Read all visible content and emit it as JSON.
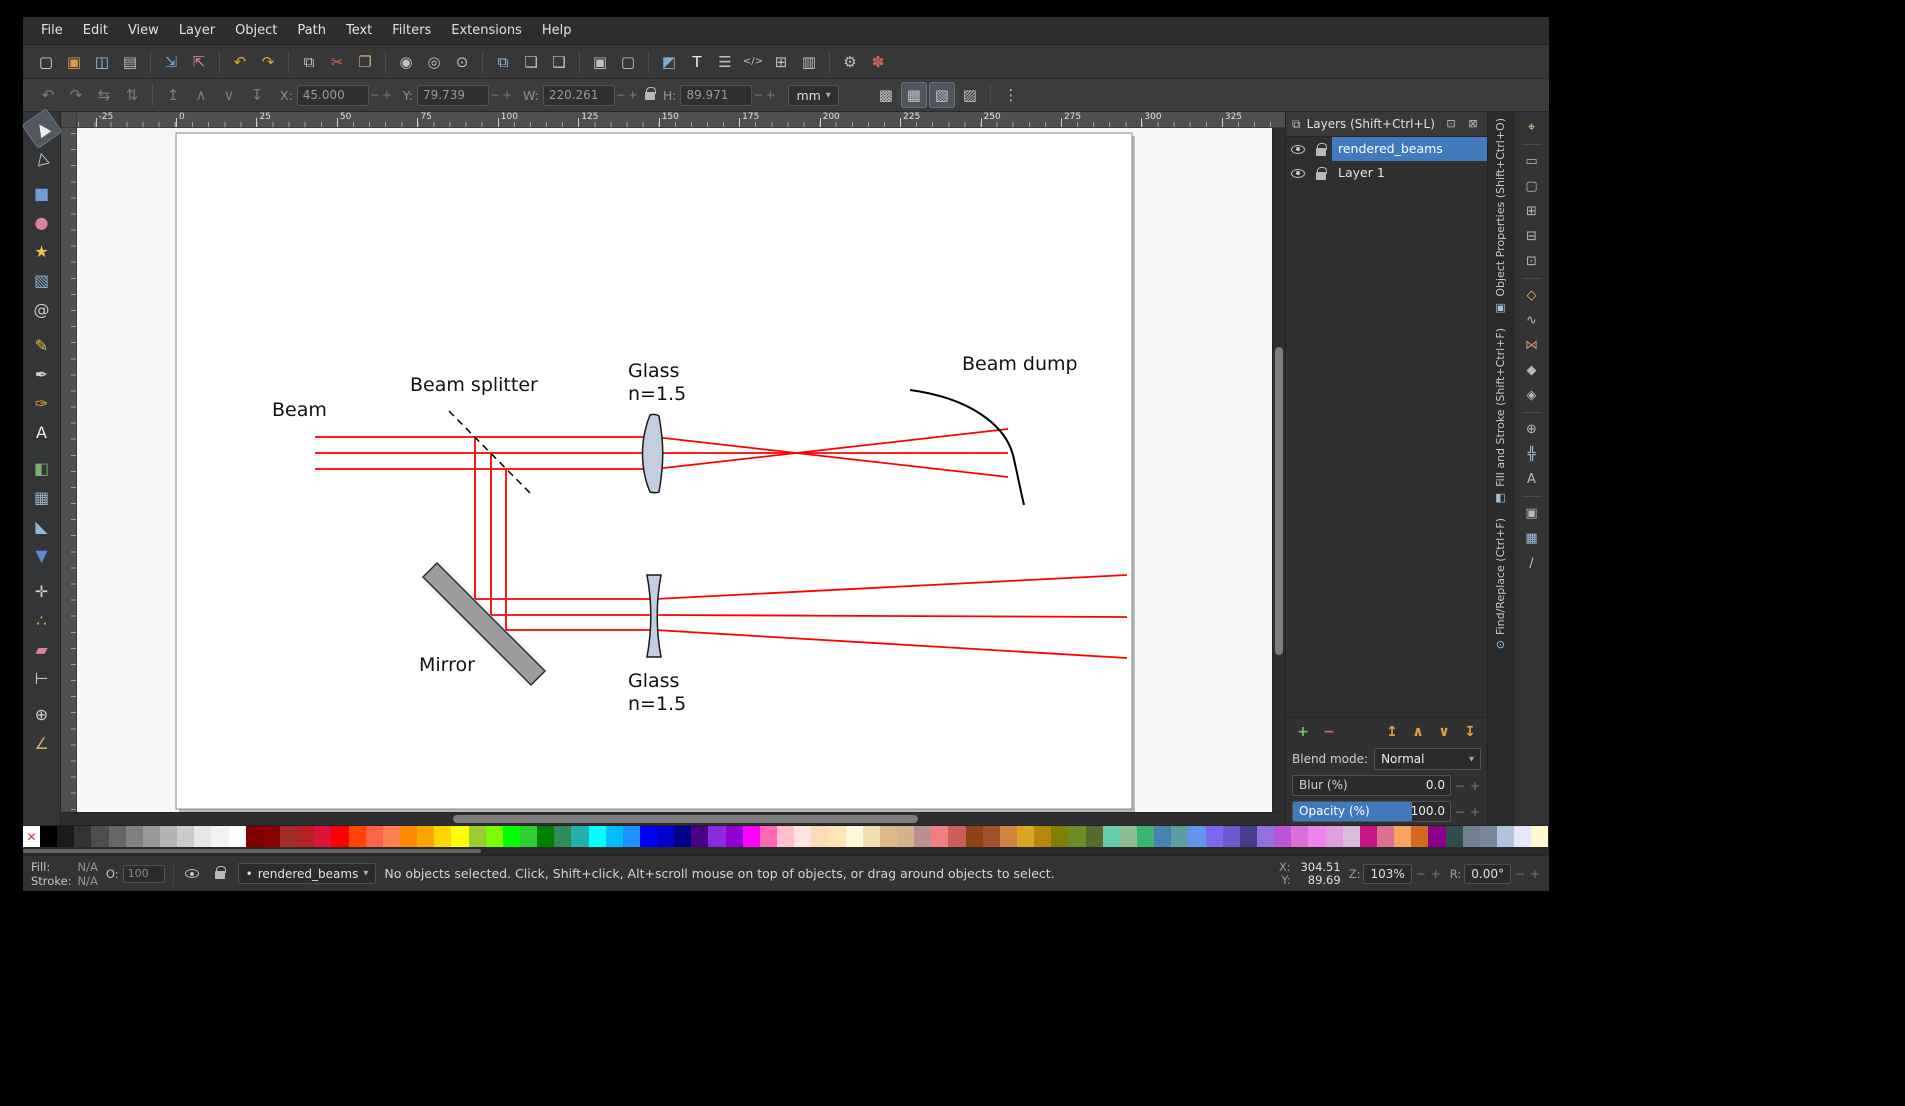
{
  "icons": {
    "minus": "−",
    "plus": "+",
    "caret": "▾",
    "bullet": "•",
    "iconify": "⊡",
    "close": "⊠",
    "layers": "⧉",
    "none": "✕"
  },
  "menubar": {
    "items": [
      "File",
      "Edit",
      "View",
      "Layer",
      "Object",
      "Path",
      "Text",
      "Filters",
      "Extensions",
      "Help"
    ]
  },
  "command_toolbar": {
    "icons": [
      {
        "name": "new-document-icon",
        "glyph": "▢",
        "color": "#d0d8de"
      },
      {
        "name": "open-document-icon",
        "glyph": "▣",
        "color": "#e09a3e"
      },
      {
        "name": "save-document-icon",
        "glyph": "◫",
        "color": "#9ec3e0"
      },
      {
        "name": "print-icon",
        "glyph": "▤",
        "color": "#b8bec4"
      },
      {
        "sep": true
      },
      {
        "name": "import-icon",
        "glyph": "⇲",
        "color": "#6fa3d8"
      },
      {
        "name": "export-icon",
        "glyph": "⇱",
        "color": "#d87fb0"
      },
      {
        "sep": true
      },
      {
        "name": "undo-icon",
        "glyph": "↶",
        "color": "#e0a23e"
      },
      {
        "name": "redo-icon",
        "glyph": "↷",
        "color": "#e0a23e"
      },
      {
        "sep": true
      },
      {
        "name": "copy-icon",
        "glyph": "⧉",
        "color": "#b8c4d0"
      },
      {
        "name": "cut-icon",
        "glyph": "✂",
        "color": "#d86a5a"
      },
      {
        "name": "paste-icon",
        "glyph": "❐",
        "color": "#c8a878"
      },
      {
        "sep": true
      },
      {
        "name": "zoom-drawing-icon",
        "glyph": "◉",
        "color": "#c0c0c0"
      },
      {
        "name": "zoom-page-icon",
        "glyph": "◎",
        "color": "#c0c0c0"
      },
      {
        "name": "zoom-selection-icon",
        "glyph": "⊙",
        "color": "#c0c0c0"
      },
      {
        "sep": true
      },
      {
        "name": "duplicate-icon",
        "glyph": "⧉",
        "color": "#8fb8e8"
      },
      {
        "name": "create-clone-icon",
        "glyph": "❏",
        "color": "#c0c0c0"
      },
      {
        "name": "unlink-clone-icon",
        "glyph": "❑",
        "color": "#c0c0c0"
      },
      {
        "sep": true
      },
      {
        "name": "group-icon",
        "glyph": "▣",
        "color": "#c0c0c0"
      },
      {
        "name": "ungroup-icon",
        "glyph": "▢",
        "color": "#c0c0c0"
      },
      {
        "sep": true
      },
      {
        "name": "fill-stroke-dialog-icon",
        "glyph": "◩",
        "color": "#7ab0d8"
      },
      {
        "name": "text-dialog-icon",
        "glyph": "T",
        "color": "#ececec"
      },
      {
        "name": "layers-dialog-icon",
        "glyph": "☰",
        "color": "#c0c0c0"
      },
      {
        "name": "xml-editor-icon",
        "glyph": "</>",
        "color": "#c0c0c0"
      },
      {
        "name": "align-distribute-icon",
        "glyph": "⊞",
        "color": "#c0c0c0"
      },
      {
        "name": "document-properties-icon",
        "glyph": "▥",
        "color": "#c0c0c0"
      },
      {
        "sep": true
      },
      {
        "name": "preferences-icon",
        "glyph": "⚙",
        "color": "#b8c0c8"
      },
      {
        "name": "customize-icon",
        "glyph": "✽",
        "color": "#d8625a"
      }
    ]
  },
  "tool_controls": {
    "left_icons": [
      {
        "name": "rotate-ccw-icon",
        "glyph": "↶",
        "color": "#7c7c7c"
      },
      {
        "name": "rotate-cw-icon",
        "glyph": "↷",
        "color": "#7c7c7c"
      },
      {
        "name": "flip-horizontal-icon",
        "glyph": "⇆",
        "color": "#7c7c7c"
      },
      {
        "name": "flip-vertical-icon",
        "glyph": "⇅",
        "color": "#7c7c7c"
      },
      {
        "sep": true
      },
      {
        "name": "raise-to-top-icon",
        "glyph": "↥",
        "color": "#7c7c7c"
      },
      {
        "name": "raise-icon",
        "glyph": "∧",
        "color": "#7c7c7c"
      },
      {
        "name": "lower-icon",
        "glyph": "∨",
        "color": "#7c7c7c"
      },
      {
        "name": "lower-to-bottom-icon",
        "glyph": "↧",
        "color": "#7c7c7c"
      }
    ],
    "x_label": "X:",
    "x_value": "45.000",
    "y_label": "Y:",
    "y_value": "79.739",
    "w_label": "W:",
    "w_value": "220.261",
    "h_label": "H:",
    "h_value": "89.971",
    "units_value": "mm",
    "right_icons": [
      {
        "name": "move-gradients-toggle-icon",
        "glyph": "▩",
        "color": "#c0c0c0"
      },
      {
        "name": "move-patterns-toggle-icon",
        "glyph": "▦",
        "color": "#c0c0c0",
        "pressed": true
      },
      {
        "name": "move-clips-toggle-icon",
        "glyph": "▧",
        "color": "#c0c0c0",
        "pressed": true
      },
      {
        "name": "transform-stroke-toggle-icon",
        "glyph": "▨",
        "color": "#c0c0c0"
      },
      {
        "sep": true
      },
      {
        "name": "toolbar-options-icon",
        "glyph": "⋮",
        "color": "#c0c0c0"
      }
    ]
  },
  "toolbox": {
    "tools": [
      {
        "name": "selector-tool",
        "glyph": "▲",
        "color": "#ececec",
        "active": true,
        "rot": -35
      },
      {
        "name": "node-tool",
        "glyph": "△",
        "color": "#cfcfcf",
        "rot": -15
      },
      {
        "sep": true
      },
      {
        "name": "rectangle-tool",
        "glyph": "■",
        "color": "#6f9fd8"
      },
      {
        "name": "ellipse-tool",
        "glyph": "●",
        "color": "#e08098"
      },
      {
        "name": "star-tool",
        "glyph": "★",
        "color": "#e8c44a"
      },
      {
        "name": "box3d-tool",
        "glyph": "▧",
        "color": "#8faecb"
      },
      {
        "name": "spiral-tool",
        "glyph": "@",
        "color": "#c8c8c8"
      },
      {
        "sep": true
      },
      {
        "name": "pencil-tool",
        "glyph": "✎",
        "color": "#e0c04a"
      },
      {
        "name": "pen-tool",
        "glyph": "✒",
        "color": "#cfcfcf"
      },
      {
        "name": "calligraphy-tool",
        "glyph": "✑",
        "color": "#e0a23e"
      },
      {
        "name": "text-tool",
        "glyph": "A",
        "color": "#ececec"
      },
      {
        "sep": true
      },
      {
        "name": "gradient-tool",
        "glyph": "◧",
        "color": "#7cb36a"
      },
      {
        "name": "mesh-gradient-tool",
        "glyph": "▦",
        "color": "#9ab0c4"
      },
      {
        "name": "dropper-tool",
        "glyph": "◣",
        "color": "#8fb8d8"
      },
      {
        "name": "paint-bucket-tool",
        "glyph": "▼",
        "color": "#5a8ad8"
      },
      {
        "sep": true
      },
      {
        "name": "tweak-tool",
        "glyph": "✛",
        "color": "#cfcfcf"
      },
      {
        "name": "spray-tool",
        "glyph": "∴",
        "color": "#d8b84a"
      },
      {
        "name": "eraser-tool",
        "glyph": "▰",
        "color": "#e08098"
      },
      {
        "name": "connector-tool",
        "glyph": "⊢",
        "color": "#cfcfcf"
      },
      {
        "sep": true
      },
      {
        "name": "zoom-tool",
        "glyph": "⊕",
        "color": "#cfcfcf"
      },
      {
        "name": "measure-tool",
        "glyph": "∠",
        "color": "#d8a85a"
      }
    ]
  },
  "ruler": {
    "labels": [
      "-25",
      "0",
      "25",
      "50",
      "75",
      "100",
      "125",
      "150",
      "175",
      "200",
      "225",
      "250",
      "275",
      "300",
      "325"
    ]
  },
  "canvas": {
    "beam_color": "#ff0000",
    "labels": {
      "beam": "Beam",
      "beam_splitter": "Beam splitter",
      "glass": "Glass",
      "refractive_index": "n=1.5",
      "beam_dump": "Beam dump",
      "mirror": "Mirror"
    }
  },
  "layers_panel": {
    "title": "Layers (Shift+Ctrl+L)",
    "layers": [
      {
        "name": "rendered_beams",
        "selected": true
      },
      {
        "name": "Layer 1",
        "selected": false
      }
    ],
    "selection_color": "#4179bd",
    "buttons": [
      {
        "name": "add-layer-button",
        "glyph": "+",
        "color": "#7cc26a"
      },
      {
        "name": "remove-layer-button",
        "glyph": "−",
        "color": "#d96a5a"
      },
      {
        "sep": true
      },
      {
        "name": "raise-layer-top-button",
        "glyph": "↥",
        "color": "#e0a23e"
      },
      {
        "name": "raise-layer-button",
        "glyph": "∧",
        "color": "#e0a23e"
      },
      {
        "name": "lower-layer-button",
        "glyph": "∨",
        "color": "#e0a23e"
      },
      {
        "name": "lower-layer-bottom-button",
        "glyph": "↧",
        "color": "#e0a23e"
      }
    ],
    "blend_mode_label": "Blend mode:",
    "blend_mode_value": "Normal",
    "blur_label": "Blur (%)",
    "blur_value": "0.0",
    "opacity_label": "Opacity (%)",
    "opacity_value": "100.0"
  },
  "dock_tabs": {
    "tabs": [
      {
        "label": "Object Properties (Shift+Ctrl+O)",
        "icon": "▣"
      },
      {
        "label": "Fill and Stroke (Shift+Ctrl+F)",
        "icon": "◧"
      },
      {
        "label": "Find/Replace (Ctrl+F)",
        "icon": "⊙"
      }
    ]
  },
  "snap_toolbar": {
    "icons": [
      {
        "name": "snap-enable-icon",
        "glyph": "⌖",
        "color": "#c8e6a0"
      },
      {
        "sep": true
      },
      {
        "name": "snap-bbox-icon",
        "glyph": "▭",
        "color": "#b9b9b9"
      },
      {
        "name": "snap-bbox-edges-icon",
        "glyph": "▢",
        "color": "#b9b9b9"
      },
      {
        "name": "snap-bbox-corners-icon",
        "glyph": "⊞",
        "color": "#b9b9b9"
      },
      {
        "name": "snap-bbox-midpoints-icon",
        "glyph": "⊟",
        "color": "#b9b9b9"
      },
      {
        "name": "snap-bbox-centers-icon",
        "glyph": "⊡",
        "color": "#b9b9b9"
      },
      {
        "sep": true
      },
      {
        "name": "snap-nodes-icon",
        "glyph": "◇",
        "color": "#e8c06a"
      },
      {
        "name": "snap-paths-icon",
        "glyph": "∿",
        "color": "#b9b9b9"
      },
      {
        "name": "snap-intersections-icon",
        "glyph": "⋈",
        "color": "#d98a7a"
      },
      {
        "name": "snap-cusp-nodes-icon",
        "glyph": "◆",
        "color": "#b9b9b9"
      },
      {
        "name": "snap-smooth-nodes-icon",
        "glyph": "◈",
        "color": "#b9b9b9"
      },
      {
        "sep": true
      },
      {
        "name": "snap-object-centers-icon",
        "glyph": "⊕",
        "color": "#b9b9b9"
      },
      {
        "name": "snap-rotation-centers-icon",
        "glyph": "╬",
        "color": "#9ec3e8"
      },
      {
        "name": "snap-text-baseline-icon",
        "glyph": "A",
        "color": "#b9b9b9"
      },
      {
        "sep": true
      },
      {
        "name": "snap-page-border-icon",
        "glyph": "▣",
        "color": "#b9b9b9"
      },
      {
        "name": "snap-grid-icon",
        "glyph": "▦",
        "color": "#9ec3e8"
      },
      {
        "name": "snap-guide-icon",
        "glyph": "∕",
        "color": "#9ec3e8"
      }
    ]
  },
  "palette": {
    "swatches": [
      "#000000",
      "#1a1a1a",
      "#333333",
      "#4d4d4d",
      "#666666",
      "#808080",
      "#999999",
      "#b3b3b3",
      "#cccccc",
      "#e6e6e6",
      "#f2f2f2",
      "#ffffff",
      "#800000",
      "#8b0000",
      "#a52a2a",
      "#b22222",
      "#dc143c",
      "#ff0000",
      "#ff4500",
      "#ff6347",
      "#ff7f50",
      "#ff8c00",
      "#ffa500",
      "#ffd700",
      "#ffff00",
      "#9acd32",
      "#7cfc00",
      "#00ff00",
      "#32cd32",
      "#008000",
      "#2e8b57",
      "#20b2aa",
      "#00ffff",
      "#00bfff",
      "#1e90ff",
      "#0000ff",
      "#0000cd",
      "#00008b",
      "#4b0082",
      "#8a2be2",
      "#9400d3",
      "#ff00ff",
      "#ff69b4",
      "#ffc0cb",
      "#ffe4e1",
      "#ffdab9",
      "#ffe4b5",
      "#fff8dc",
      "#f5deb3",
      "#deb887",
      "#d2b48c",
      "#bc8f8f",
      "#f08080",
      "#cd5c5c",
      "#8b4513",
      "#a0522d",
      "#cd853f",
      "#daa520",
      "#b8860b",
      "#808000",
      "#6b8e23",
      "#556b2f",
      "#66cdaa",
      "#8fbc8f",
      "#3cb371",
      "#4682b4",
      "#5f9ea0",
      "#6495ed",
      "#7b68ee",
      "#6a5acd",
      "#483d8b",
      "#9370db",
      "#ba55d3",
      "#da70d6",
      "#ee82ee",
      "#dda0dd",
      "#d8bfd8",
      "#c71585",
      "#db7093",
      "#f4a460",
      "#d2691e",
      "#8b008b",
      "#2f4f4f",
      "#708090",
      "#778899",
      "#b0c4de",
      "#e6e6fa",
      "#fffacd"
    ]
  },
  "statusbar": {
    "fill_label": "Fill:",
    "fill_value": "N/A",
    "stroke_label": "Stroke:",
    "stroke_value": "N/A",
    "opacity_label": "O:",
    "opacity_value": "100",
    "layer_indicator": "rendered_beams",
    "message": "No objects selected. Click, Shift+click, Alt+scroll mouse on top of objects, or drag around objects to select.",
    "x_label": "X:",
    "x_value": "304.51",
    "y_label": "Y:",
    "y_value": "89.69",
    "zoom_label": "Z:",
    "zoom_value": "103%",
    "rotation_label": "R:",
    "rotation_value": "0.00°"
  }
}
